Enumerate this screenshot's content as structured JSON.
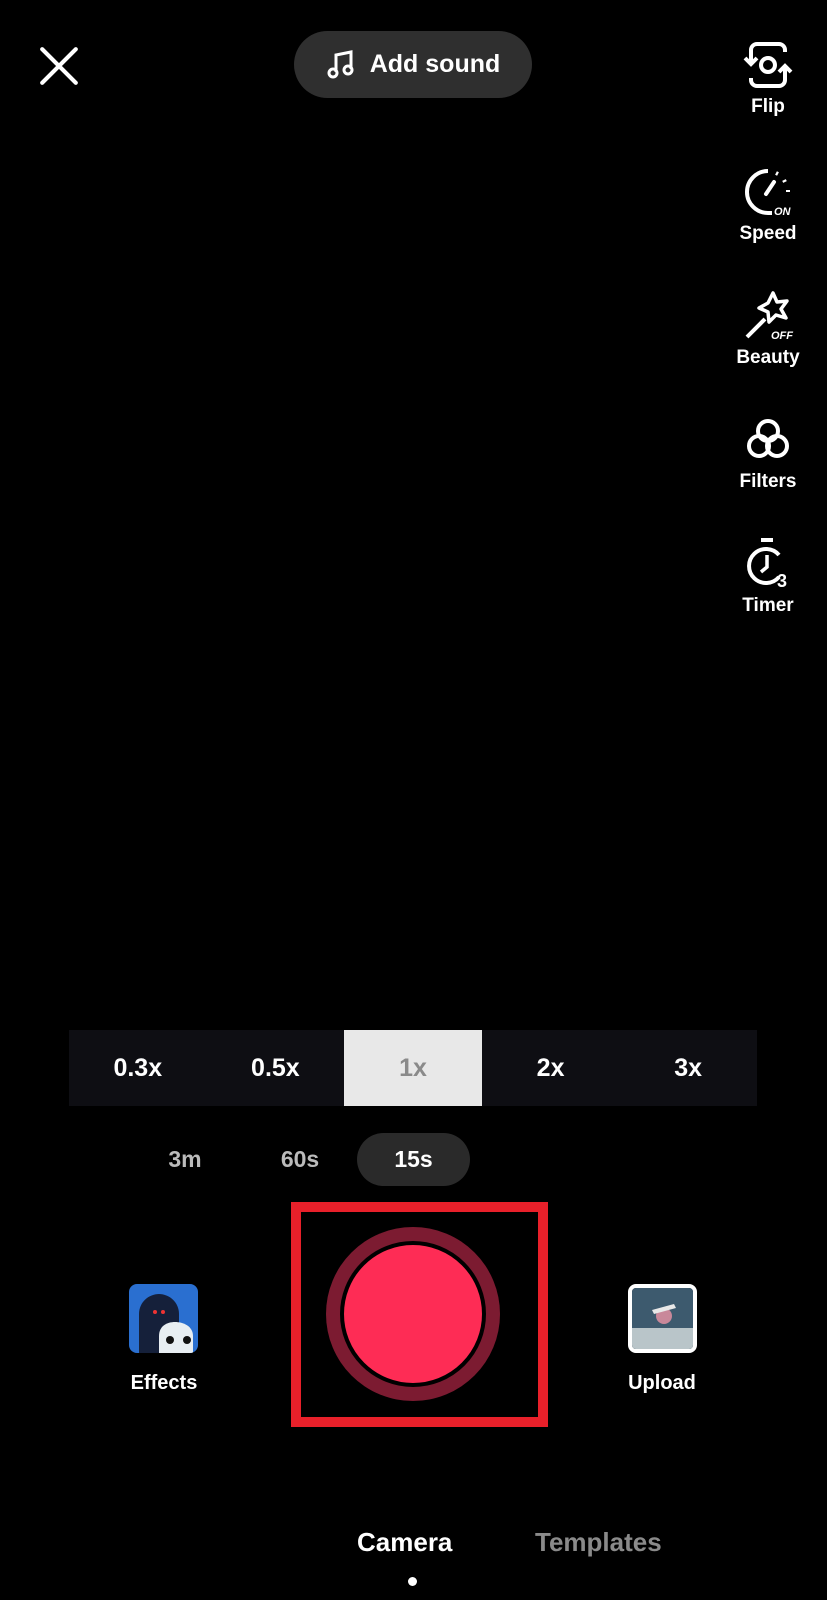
{
  "top": {
    "add_sound_label": "Add sound"
  },
  "side_tools": [
    {
      "label": "Flip",
      "icon": "flip-camera-icon"
    },
    {
      "label": "Speed",
      "icon": "speed-icon",
      "badge": "ON"
    },
    {
      "label": "Beauty",
      "icon": "beauty-wand-icon",
      "badge": "OFF"
    },
    {
      "label": "Filters",
      "icon": "filters-icon"
    },
    {
      "label": "Timer",
      "icon": "timer-icon",
      "badge": "3"
    }
  ],
  "zoom_options": [
    "0.3x",
    "0.5x",
    "1x",
    "2x",
    "3x"
  ],
  "zoom_selected": "1x",
  "durations": [
    "3m",
    "60s",
    "15s"
  ],
  "duration_selected": "15s",
  "effects_label": "Effects",
  "upload_label": "Upload",
  "tabs": [
    "Camera",
    "Templates"
  ],
  "tab_selected": "Camera",
  "colors": {
    "record": "#fe2c55",
    "record_ring": "#7c1b31",
    "highlight": "#e8202a"
  }
}
